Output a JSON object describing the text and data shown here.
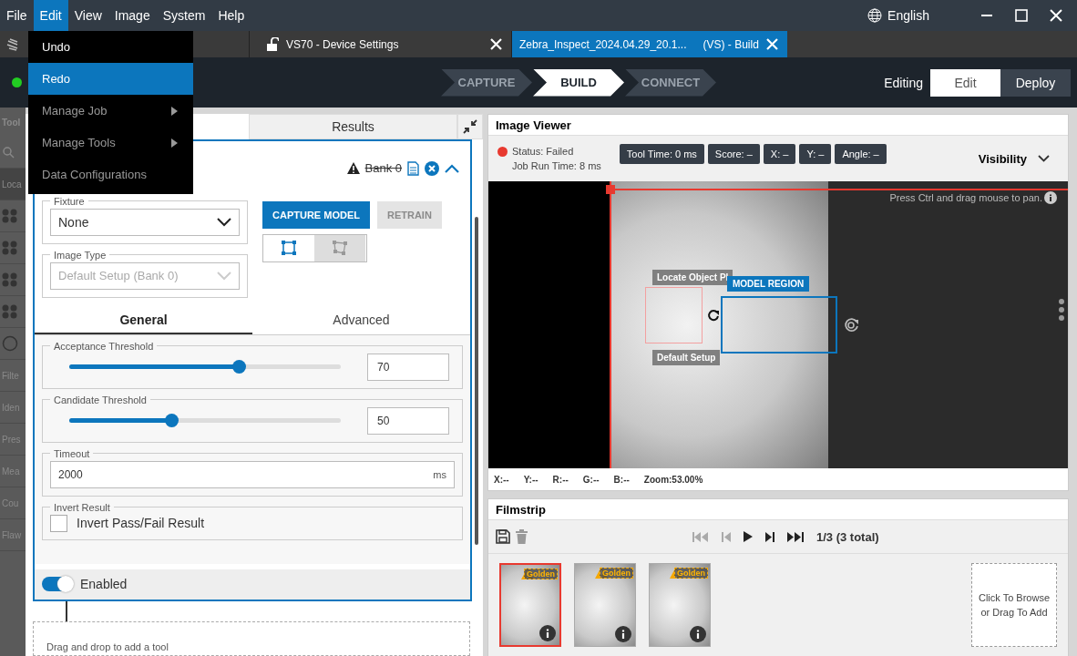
{
  "menu_bar": {
    "items": [
      {
        "label": "File",
        "selected": false
      },
      {
        "label": "Edit",
        "selected": true
      },
      {
        "label": "View",
        "selected": false
      },
      {
        "label": "Image",
        "selected": false
      },
      {
        "label": "System",
        "selected": false
      },
      {
        "label": "Help",
        "selected": false
      }
    ],
    "language": "English"
  },
  "edit_menu": {
    "items": [
      {
        "label": "Undo",
        "selected": false,
        "disabled": false,
        "submenu": false
      },
      {
        "label": "Redo",
        "selected": true,
        "disabled": false,
        "submenu": false
      },
      {
        "label": "Manage Job",
        "selected": false,
        "disabled": true,
        "submenu": true
      },
      {
        "label": "Manage Tools",
        "selected": false,
        "disabled": true,
        "submenu": true
      },
      {
        "label": "Data Configurations",
        "selected": false,
        "disabled": true,
        "submenu": false
      }
    ]
  },
  "document_tabs": [
    {
      "label": "VS70 - Device Settings",
      "selected": false,
      "locked": true
    },
    {
      "label": "Zebra_Inspect_2024.04.29_20.1...",
      "suffix": "(VS) - Build",
      "selected": true,
      "locked": false
    }
  ],
  "header": {
    "connected": true,
    "steps": [
      {
        "label": "CAPTURE",
        "selected": false
      },
      {
        "label": "BUILD",
        "selected": true
      },
      {
        "label": "CONNECT",
        "selected": false
      }
    ],
    "mode_label": "Editing",
    "modes": [
      {
        "label": "Edit",
        "selected": true
      },
      {
        "label": "Deploy",
        "selected": false
      }
    ]
  },
  "toolbox": {
    "title": "Tool",
    "items": [
      {
        "kind": "search"
      },
      {
        "kind": "text",
        "label": "Loca",
        "selected": true
      },
      {
        "kind": "icon"
      },
      {
        "kind": "icon"
      },
      {
        "kind": "icon"
      },
      {
        "kind": "icon"
      },
      {
        "kind": "circle"
      },
      {
        "kind": "text",
        "label": "Filte",
        "selected": false
      },
      {
        "kind": "text",
        "label": "Iden",
        "selected": false
      },
      {
        "kind": "text",
        "label": "Pres",
        "selected": false
      },
      {
        "kind": "text",
        "label": "Mea",
        "selected": false
      },
      {
        "kind": "text",
        "label": "Cou",
        "selected": false
      },
      {
        "kind": "text",
        "label": "Flaw",
        "selected": false
      }
    ]
  },
  "tool_panel": {
    "tabs": [
      {
        "label": "Results",
        "selected": false
      }
    ],
    "card": {
      "bank": "Bank 0",
      "warning": true,
      "fixture": {
        "legend": "Fixture",
        "value": "None",
        "disabled": false
      },
      "image_type": {
        "legend": "Image Type",
        "value": "Default Setup (Bank 0)",
        "disabled": true
      },
      "buttons": [
        {
          "label": "CAPTURE MODEL",
          "disabled": false
        },
        {
          "label": "RETRAIN",
          "disabled": true
        }
      ],
      "region_shapes": [
        {
          "kind": "rectangle",
          "selected": true
        },
        {
          "kind": "polygon",
          "selected": false
        }
      ],
      "subtabs": [
        {
          "label": "General",
          "selected": true
        },
        {
          "label": "Advanced",
          "selected": false
        }
      ],
      "sliders": [
        {
          "legend": "Acceptance Threshold",
          "level": 0.625,
          "value": "70"
        },
        {
          "legend": "Candidate Threshold",
          "level": 0.375,
          "value": "50"
        }
      ],
      "timeout": {
        "legend": "Timeout",
        "value": "2000",
        "unit": "ms"
      },
      "invert": {
        "legend": "Invert Result",
        "label": "Invert Pass/Fail Result",
        "checked": false
      },
      "enabled": {
        "label": "Enabled",
        "on": true
      }
    },
    "drop_hint": "Drag and drop to add a tool"
  },
  "image_viewer": {
    "title": "Image Viewer",
    "status": {
      "label": "Status:",
      "value": "Failed",
      "color": "#e8392f"
    },
    "run_time": "Job Run Time: 8 ms",
    "chips": [
      "Tool Time: 0 ms",
      "Score: –",
      "X: –",
      "Y: –",
      "Angle: –"
    ],
    "visibility": "Visibility",
    "pan_hint": "Press Ctrl and drag mouse to pan.",
    "overlay_labels": [
      "Locate Object Pl",
      "Default Setup"
    ],
    "model_region": "MODEL REGION",
    "readouts": [
      "X:--",
      "Y:--",
      "R:--",
      "G:--",
      "B:--",
      "Zoom:53.00%"
    ]
  },
  "filmstrip": {
    "title": "Filmstrip",
    "counter": "1/3 (3 total)",
    "thumbnails": [
      {
        "selected": true,
        "badge": "Golden"
      },
      {
        "selected": false,
        "badge": "Golden"
      },
      {
        "selected": false,
        "badge": "Golden"
      }
    ],
    "drop_hint": "Click To Browse or Drag To Add"
  }
}
